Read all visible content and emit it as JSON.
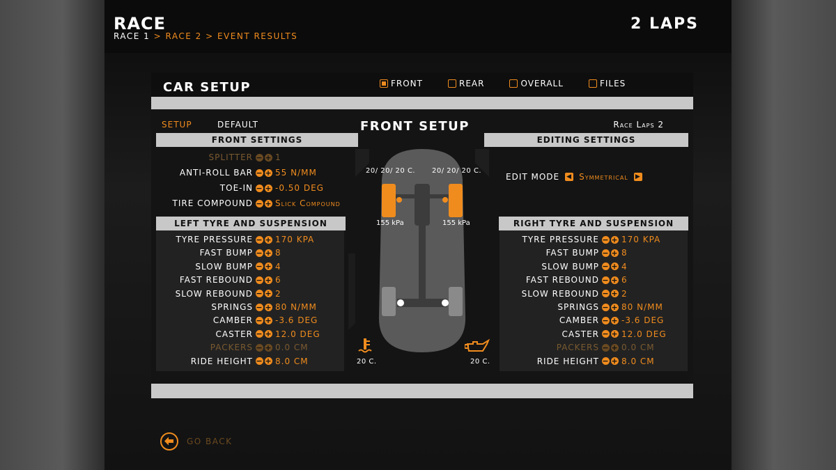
{
  "header": {
    "title": "RACE",
    "breadcrumb": {
      "current": "RACE 1",
      "sep1": ">",
      "step2": "RACE 2",
      "sep2": ">",
      "step3": "EVENT RESULTS"
    },
    "laps": "2 LAPS"
  },
  "panel": {
    "title": "CAR SETUP",
    "tabs": [
      {
        "label": "FRONT",
        "selected": true
      },
      {
        "label": "REAR",
        "selected": false
      },
      {
        "label": "OVERALL",
        "selected": false
      },
      {
        "label": "FILES",
        "selected": false
      }
    ],
    "subtabs": {
      "setup": "SETUP",
      "default": "DEFAULT"
    },
    "section_title": "FRONT SETUP",
    "race_laps": "Race Laps 2"
  },
  "front_settings": {
    "title": "FRONT SETTINGS",
    "rows": [
      {
        "label": "SPLITTER",
        "value": "1",
        "enabled": false
      },
      {
        "label": "ANTI-ROLL BAR",
        "value": "55 N/MM",
        "enabled": true
      },
      {
        "label": "TOE-IN",
        "value": "-0.50 DEG",
        "enabled": true
      },
      {
        "label": "TIRE COMPOUND",
        "value": "Slick Compound",
        "enabled": true
      }
    ]
  },
  "editing_settings": {
    "title": "EDITING SETTINGS",
    "edit_mode_label": "EDIT MODE",
    "edit_mode_value": "Symmetrical"
  },
  "left_tyre": {
    "title": "LEFT TYRE AND SUSPENSION",
    "rows": [
      {
        "label": "TYRE PRESSURE",
        "value": "170 KPA",
        "enabled": true
      },
      {
        "label": "FAST BUMP",
        "value": "8",
        "enabled": true
      },
      {
        "label": "SLOW BUMP",
        "value": "4",
        "enabled": true
      },
      {
        "label": "FAST REBOUND",
        "value": "6",
        "enabled": true
      },
      {
        "label": "SLOW REBOUND",
        "value": "2",
        "enabled": true
      },
      {
        "label": "SPRINGS",
        "value": "80 N/MM",
        "enabled": true
      },
      {
        "label": "CAMBER",
        "value": "-3.6 DEG",
        "enabled": true
      },
      {
        "label": "CASTER",
        "value": "12.0 DEG",
        "enabled": true
      },
      {
        "label": "PACKERS",
        "value": "0.0 CM",
        "enabled": false
      },
      {
        "label": "RIDE HEIGHT",
        "value": "8.0 CM",
        "enabled": true
      }
    ]
  },
  "right_tyre": {
    "title": "RIGHT TYRE AND SUSPENSION",
    "rows": [
      {
        "label": "TYRE PRESSURE",
        "value": "170 KPA",
        "enabled": true
      },
      {
        "label": "FAST BUMP",
        "value": "8",
        "enabled": true
      },
      {
        "label": "SLOW BUMP",
        "value": "4",
        "enabled": true
      },
      {
        "label": "FAST REBOUND",
        "value": "6",
        "enabled": true
      },
      {
        "label": "SLOW REBOUND",
        "value": "2",
        "enabled": true
      },
      {
        "label": "SPRINGS",
        "value": "80 N/MM",
        "enabled": true
      },
      {
        "label": "CAMBER",
        "value": "-3.6 DEG",
        "enabled": true
      },
      {
        "label": "CASTER",
        "value": "12.0 DEG",
        "enabled": true
      },
      {
        "label": "PACKERS",
        "value": "0.0 CM",
        "enabled": false
      },
      {
        "label": "RIDE HEIGHT",
        "value": "8.0 CM",
        "enabled": true
      }
    ]
  },
  "car_diagram": {
    "left_tyre_temps": "20/ 20/ 20 C.",
    "right_tyre_temps": "20/ 20/ 20 C.",
    "left_pressure": "155 kPa",
    "right_pressure": "155 kPa",
    "water_temp": "20 C.",
    "oil_temp": "20 C.",
    "water_icon": "coolant-temp-icon",
    "oil_icon": "oil-can-icon"
  },
  "footer": {
    "go_back": "GO BACK"
  },
  "colors": {
    "accent": "#f08c1e",
    "header_bar": "#c8c8c8",
    "background": "#0e0e0e"
  }
}
